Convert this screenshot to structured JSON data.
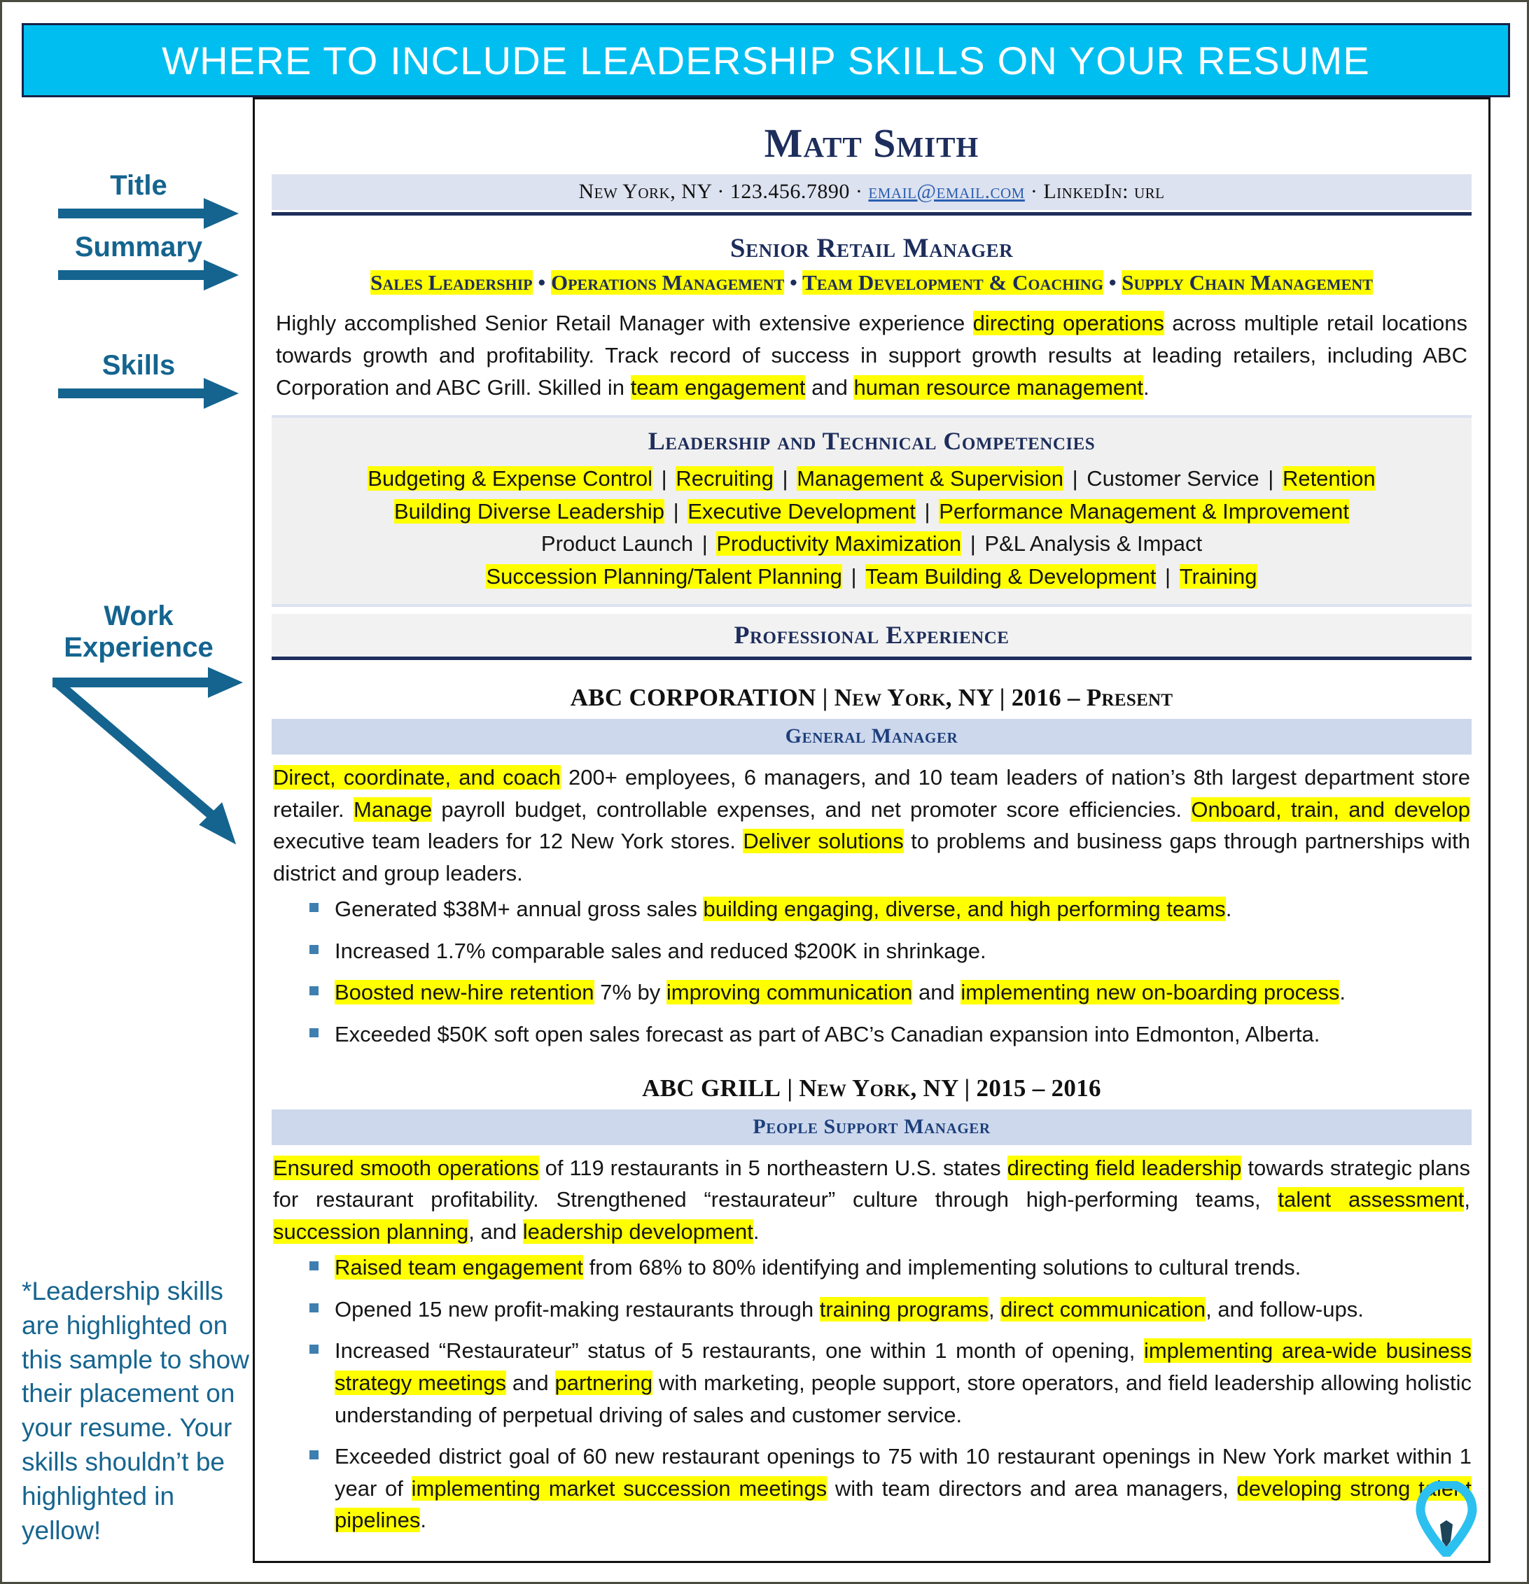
{
  "banner": {
    "title": "WHERE TO INCLUDE LEADERSHIP SKILLS ON YOUR RESUME"
  },
  "annotations": {
    "title_label": "Title",
    "summary_label": "Summary",
    "skills_label": "Skills",
    "work_label_line1": "Work",
    "work_label_line2": "Experience",
    "footnote": "*Leadership skills are highlighted on this sample to show their placement on your resume. Your skills shouldn’t be highlighted in yellow!",
    "accent_color": "#14648f"
  },
  "resume": {
    "name": "Matt Smith",
    "contact": {
      "location": "New York, NY",
      "sep1": " · ",
      "phone": "123.456.7890",
      "sep2": " · ",
      "email": "email@email.com",
      "sep3": " · ",
      "linkedin": "LinkedIn: url"
    },
    "job_title": "Senior Retail Manager",
    "keywords": [
      "Sales Leadership",
      "Operations Management",
      "Team Development & Coaching",
      "Supply Chain Management"
    ],
    "keyword_separator": " • ",
    "summary": {
      "p1": "Highly accomplished Senior Retail Manager with extensive experience ",
      "h1": "directing operations",
      "p2": " across multiple retail locations towards growth and profitability. Track record of success in support growth results at leading retailers, including ABC Corporation and ABC Grill. Skilled in ",
      "h2": "team engagement",
      "p3": " and ",
      "h3": "human resource management",
      "p4": "."
    },
    "skills_section": {
      "heading": "Leadership and Technical Competencies",
      "rows": [
        [
          {
            "text": "Budgeting & Expense Control",
            "hl": true
          },
          {
            "text": "Recruiting",
            "hl": true
          },
          {
            "text": "Management & Supervision",
            "hl": true
          },
          {
            "text": "Customer Service",
            "hl": false
          },
          {
            "text": "Retention",
            "hl": true
          }
        ],
        [
          {
            "text": "Building Diverse Leadership",
            "hl": true
          },
          {
            "text": "Executive Development",
            "hl": true
          },
          {
            "text": "Performance Management & Improvement",
            "hl": true
          }
        ],
        [
          {
            "text": "Product Launch",
            "hl": false
          },
          {
            "text": "Productivity Maximization",
            "hl": true
          },
          {
            "text": "P&L Analysis & Impact",
            "hl": false
          }
        ],
        [
          {
            "text": "Succession Planning/Talent Planning",
            "hl": true
          },
          {
            "text": "Team Building & Development",
            "hl": true
          },
          {
            "text": "Training",
            "hl": true
          }
        ]
      ],
      "divider": "|"
    },
    "experience_heading": "Professional Experience",
    "jobs": [
      {
        "employer": "ABC CORPORATION",
        "meta": " | New York, NY | 2016 – Present",
        "role": "General Manager",
        "paragraph": [
          {
            "text": "Direct, coordinate, and coach",
            "hl": true
          },
          {
            "text": " 200+ employees, 6 managers, and 10 team leaders of nation’s 8th largest department store retailer. ",
            "hl": false
          },
          {
            "text": "Manage",
            "hl": true
          },
          {
            "text": " payroll budget, controllable expenses, and net promoter score efficiencies. ",
            "hl": false
          },
          {
            "text": "Onboard, train, and develop",
            "hl": true
          },
          {
            "text": " executive team leaders for 12 New York stores. ",
            "hl": false
          },
          {
            "text": "Deliver solutions",
            "hl": true
          },
          {
            "text": " to problems and business gaps through partnerships with district and group leaders.",
            "hl": false
          }
        ],
        "bullets": [
          [
            {
              "text": "Generated $38M+ annual gross sales ",
              "hl": false
            },
            {
              "text": "building engaging, diverse, and high performing teams",
              "hl": true
            },
            {
              "text": ".",
              "hl": false
            }
          ],
          [
            {
              "text": "Increased 1.7% comparable sales and reduced $200K in shrinkage.",
              "hl": false
            }
          ],
          [
            {
              "text": "Boosted new-hire retention",
              "hl": true
            },
            {
              "text": " 7% by ",
              "hl": false
            },
            {
              "text": "improving communication",
              "hl": true
            },
            {
              "text": " and ",
              "hl": false
            },
            {
              "text": "implementing new on-boarding process",
              "hl": true
            },
            {
              "text": ".",
              "hl": false
            }
          ],
          [
            {
              "text": "Exceeded $50K soft open sales forecast as part of ABC’s Canadian expansion into Edmonton, Alberta.",
              "hl": false
            }
          ]
        ]
      },
      {
        "employer": "ABC GRILL",
        "meta": " | New York, NY | 2015 – 2016",
        "role": "People Support Manager",
        "paragraph": [
          {
            "text": "Ensured smooth operations",
            "hl": true
          },
          {
            "text": " of 119 restaurants in 5 northeastern U.S. states ",
            "hl": false
          },
          {
            "text": "directing field leadership",
            "hl": true
          },
          {
            "text": " towards strategic plans for restaurant profitability. Strengthened “restaurateur” culture through high-performing teams, ",
            "hl": false
          },
          {
            "text": "talent assessment",
            "hl": true
          },
          {
            "text": ", ",
            "hl": false
          },
          {
            "text": "succession planning",
            "hl": true
          },
          {
            "text": ", and ",
            "hl": false
          },
          {
            "text": "leadership development",
            "hl": true
          },
          {
            "text": ".",
            "hl": false
          }
        ],
        "bullets": [
          [
            {
              "text": "Raised team engagement",
              "hl": true
            },
            {
              "text": " from 68% to 80% identifying and implementing solutions to cultural trends.",
              "hl": false
            }
          ],
          [
            {
              "text": "Opened 15 new profit-making restaurants through ",
              "hl": false
            },
            {
              "text": "training programs",
              "hl": true
            },
            {
              "text": ", ",
              "hl": false
            },
            {
              "text": "direct communication",
              "hl": true
            },
            {
              "text": ", and follow-ups.",
              "hl": false
            }
          ],
          [
            {
              "text": "Increased “Restaurateur” status of 5 restaurants, one within 1 month of opening, ",
              "hl": false
            },
            {
              "text": "implementing area-wide business strategy meetings",
              "hl": true
            },
            {
              "text": " and ",
              "hl": false
            },
            {
              "text": "partnering",
              "hl": true
            },
            {
              "text": " with marketing, people support, store operators, and field leadership allowing holistic understanding of perpetual driving of sales and customer service.",
              "hl": false
            }
          ],
          [
            {
              "text": "Exceeded district goal of 60 new restaurant openings to 75 with 10 restaurant openings in New York market within 1 year of ",
              "hl": false
            },
            {
              "text": "implementing market succession meetings",
              "hl": true
            },
            {
              "text": " with team directors and area managers, ",
              "hl": false
            },
            {
              "text": "developing strong talent pipelines",
              "hl": true
            },
            {
              "text": ".",
              "hl": false
            }
          ]
        ]
      }
    ]
  },
  "logo": {
    "name": "map-pin-tie-logo",
    "pin_color": "#2bc0ef",
    "tie_color": "#1d4458"
  }
}
